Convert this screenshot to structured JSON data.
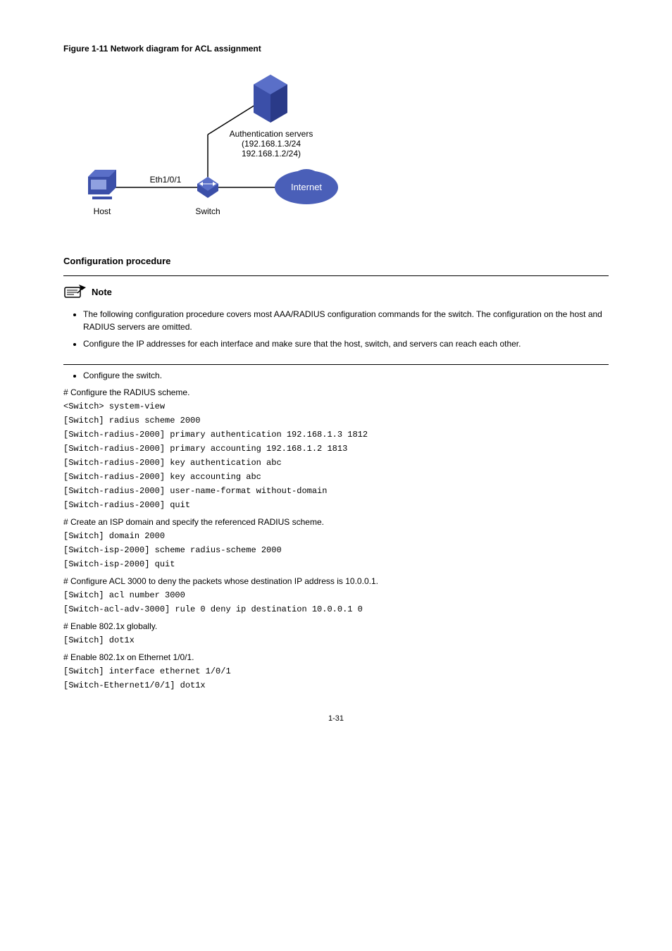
{
  "figure": {
    "title": "Figure 1-11 Network diagram for ACL assignment",
    "labels": {
      "auth_servers_line1": "Authentication servers",
      "auth_servers_line2": "(192.168.1.3/24",
      "auth_servers_line3": "192.168.1.2/24)",
      "eth": "Eth1/0/1",
      "host": "Host",
      "switch": "Switch",
      "internet": "Internet"
    }
  },
  "sections": {
    "config_proc": "Configuration procedure"
  },
  "note": {
    "label": "Note",
    "bullets": [
      "The following configuration procedure covers most AAA/RADIUS configuration commands for the switch. The configuration on the host and RADIUS servers are omitted.",
      "Configure the IP addresses for each interface and make sure that the host, switch, and servers can reach each other."
    ]
  },
  "main_bullet": "Configure the switch.",
  "steps": [
    {
      "desc": "# Configure the RADIUS scheme.",
      "lines": [
        "<Switch> system-view",
        "[Switch] radius scheme 2000",
        "[Switch-radius-2000] primary authentication 192.168.1.3 1812",
        "[Switch-radius-2000] primary accounting 192.168.1.2 1813",
        "[Switch-radius-2000] key authentication abc",
        "[Switch-radius-2000] key accounting abc",
        "[Switch-radius-2000] user-name-format without-domain",
        "[Switch-radius-2000] quit"
      ]
    },
    {
      "desc": "# Create an ISP domain and specify the referenced RADIUS scheme.",
      "lines": [
        "[Switch] domain 2000",
        "[Switch-isp-2000] scheme radius-scheme 2000",
        "[Switch-isp-2000] quit"
      ]
    },
    {
      "desc": "# Configure ACL 3000 to deny the packets whose destination IP address is 10.0.0.1.",
      "lines": [
        "[Switch] acl number 3000",
        "[Switch-acl-adv-3000] rule 0 deny ip destination 10.0.0.1 0"
      ]
    },
    {
      "desc": "# Enable 802.1x globally.",
      "lines": [
        "[Switch] dot1x"
      ]
    },
    {
      "desc": "# Enable 802.1x on Ethernet 1/0/1.",
      "lines": [
        "[Switch] interface ethernet 1/0/1",
        "[Switch-Ethernet1/0/1] dot1x"
      ]
    }
  ],
  "page_number": "1-31"
}
